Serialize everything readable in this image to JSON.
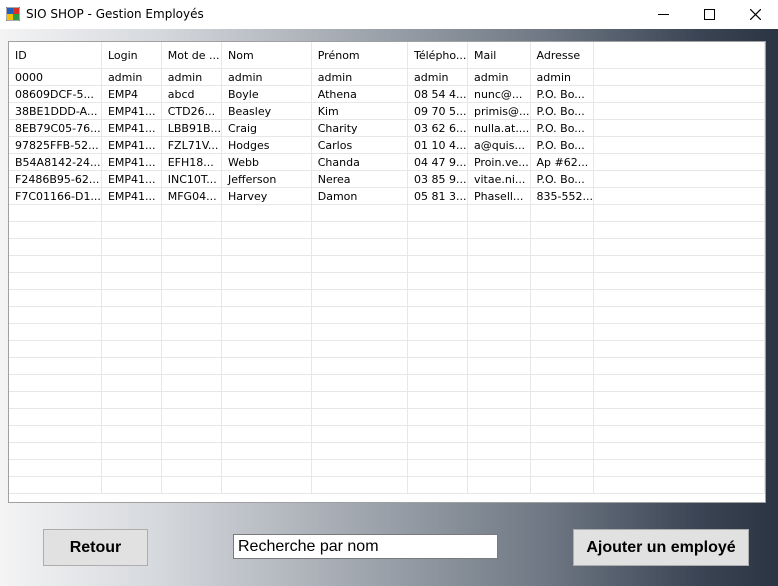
{
  "window": {
    "title": "SIO SHOP - Gestion Employés",
    "icon": "app-icon",
    "controls": [
      "minimize-icon",
      "maximize-icon",
      "close-icon"
    ]
  },
  "grid": {
    "columns": [
      "ID",
      "Login",
      "Mot de ...",
      "Nom",
      "Prénom",
      "Télépho...",
      "Mail",
      "Adresse"
    ],
    "rows": [
      [
        "0000",
        "admin",
        "admin",
        "admin",
        "admin",
        "admin",
        "admin",
        "admin"
      ],
      [
        "08609DCF-5...",
        "EMP4",
        "abcd",
        "Boyle",
        "Athena",
        "08 54 4...",
        "nunc@...",
        "P.O. Bo..."
      ],
      [
        "38BE1DDD-A...",
        "EMP41...",
        "CTD26...",
        "Beasley",
        "Kim",
        "09 70 5...",
        "primis@...",
        "P.O. Bo..."
      ],
      [
        "8EB79C05-76...",
        "EMP41...",
        "LBB91B...",
        "Craig",
        "Charity",
        "03 62 6...",
        "nulla.at....",
        "P.O. Bo..."
      ],
      [
        "97825FFB-52...",
        "EMP41...",
        "FZL71V...",
        "Hodges",
        "Carlos",
        "01 10 4...",
        "a@quis...",
        "P.O. Bo..."
      ],
      [
        "B54A8142-24...",
        "EMP41...",
        "EFH18...",
        "Webb",
        "Chanda",
        "04 47 9...",
        "Proin.ve...",
        "Ap #62..."
      ],
      [
        "F2486B95-62...",
        "EMP41...",
        "INC10T...",
        "Jefferson",
        "Nerea",
        "03 85 9...",
        "vitae.ni...",
        "P.O. Bo..."
      ],
      [
        "F7C01166-D1...",
        "EMP41...",
        "MFG04...",
        "Harvey",
        "Damon",
        "05 81 3...",
        "Phasell...",
        "835-552..."
      ]
    ]
  },
  "buttons": {
    "back": "Retour",
    "add": "Ajouter un employé"
  },
  "search": {
    "value": "Recherche par nom"
  }
}
